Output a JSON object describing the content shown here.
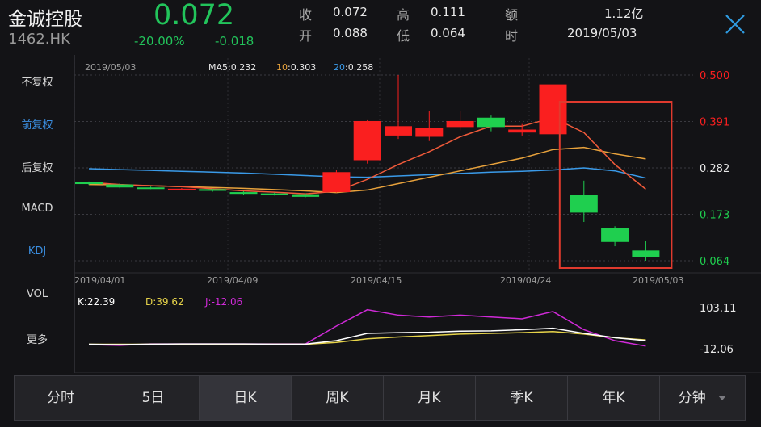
{
  "header": {
    "name": "金诚控股",
    "code": "1462.HK",
    "price": "0.072",
    "change_pct": "-20.00%",
    "change_amt": "-0.018",
    "quote": [
      {
        "label": "收",
        "value": "0.072"
      },
      {
        "label": "开",
        "value": "0.088"
      },
      {
        "label": "高",
        "value": "0.111"
      },
      {
        "label": "低",
        "value": "0.064"
      },
      {
        "label": "额",
        "value": "1.12亿"
      },
      {
        "label": "时",
        "value": "2019/05/03"
      }
    ],
    "close_icon": "close-icon"
  },
  "sidebar": {
    "items": [
      {
        "label": "不复权",
        "active": false
      },
      {
        "label": "前复权",
        "active": true
      },
      {
        "label": "后复权",
        "active": false
      },
      {
        "label": "MACD",
        "active": false
      },
      {
        "label": "KDJ",
        "active": true
      },
      {
        "label": "VOL",
        "active": false
      },
      {
        "label": "更多",
        "active": false
      }
    ]
  },
  "chart_data": {
    "type": "candlestick",
    "date_label": "2019/05/03",
    "ma_legend": {
      "ma5": {
        "name": "MA5",
        "value": "0.232",
        "color": "#e8e8e8"
      },
      "ma10": {
        "name": "10",
        "value": "0.303",
        "color": "#e8a23c"
      },
      "ma20": {
        "name": "20",
        "value": "0.258",
        "color": "#3a9ae8"
      }
    },
    "y_ticks": [
      "0.500",
      "0.391",
      "0.282",
      "0.173",
      "0.064"
    ],
    "y_range": [
      0.064,
      0.5
    ],
    "x_ticks": [
      "2019/04/01",
      "2019/04/09",
      "2019/04/15",
      "2019/04/24",
      "2019/05/03"
    ],
    "candles": [
      {
        "o": 0.248,
        "c": 0.244,
        "h": 0.25,
        "l": 0.242
      },
      {
        "o": 0.243,
        "c": 0.236,
        "h": 0.246,
        "l": 0.234
      },
      {
        "o": 0.236,
        "c": 0.234,
        "h": 0.238,
        "l": 0.232
      },
      {
        "o": 0.233,
        "c": 0.233,
        "h": 0.235,
        "l": 0.231
      },
      {
        "o": 0.232,
        "c": 0.228,
        "h": 0.233,
        "l": 0.226
      },
      {
        "o": 0.225,
        "c": 0.221,
        "h": 0.227,
        "l": 0.219
      },
      {
        "o": 0.222,
        "c": 0.218,
        "h": 0.224,
        "l": 0.217
      },
      {
        "o": 0.22,
        "c": 0.214,
        "h": 0.222,
        "l": 0.213
      },
      {
        "o": 0.225,
        "c": 0.272,
        "h": 0.278,
        "l": 0.224
      },
      {
        "o": 0.3,
        "c": 0.392,
        "h": 0.394,
        "l": 0.292
      },
      {
        "o": 0.358,
        "c": 0.38,
        "h": 0.5,
        "l": 0.35
      },
      {
        "o": 0.355,
        "c": 0.376,
        "h": 0.415,
        "l": 0.345
      },
      {
        "o": 0.378,
        "c": 0.392,
        "h": 0.415,
        "l": 0.37
      },
      {
        "o": 0.4,
        "c": 0.378,
        "h": 0.405,
        "l": 0.368
      },
      {
        "o": 0.365,
        "c": 0.372,
        "h": 0.385,
        "l": 0.358
      },
      {
        "o": 0.361,
        "c": 0.478,
        "h": 0.48,
        "l": 0.355
      },
      {
        "o": 0.219,
        "c": 0.177,
        "h": 0.252,
        "l": 0.155
      },
      {
        "o": 0.14,
        "c": 0.108,
        "h": 0.145,
        "l": 0.098
      },
      {
        "o": 0.088,
        "c": 0.072,
        "h": 0.111,
        "l": 0.064
      }
    ],
    "ma5": [
      0.248,
      0.243,
      0.24,
      0.238,
      0.233,
      0.228,
      0.225,
      0.221,
      0.227,
      0.255,
      0.29,
      0.32,
      0.355,
      0.38,
      0.38,
      0.4,
      0.365,
      0.29,
      0.232
    ],
    "ma10": [
      0.243,
      0.242,
      0.24,
      0.238,
      0.236,
      0.234,
      0.231,
      0.228,
      0.224,
      0.23,
      0.245,
      0.26,
      0.275,
      0.29,
      0.305,
      0.325,
      0.33,
      0.315,
      0.303
    ],
    "ma20": [
      0.28,
      0.278,
      0.276,
      0.274,
      0.272,
      0.27,
      0.267,
      0.264,
      0.261,
      0.26,
      0.263,
      0.266,
      0.269,
      0.272,
      0.274,
      0.277,
      0.282,
      0.275,
      0.258
    ],
    "highlight": {
      "from_index": 16,
      "to_index": 18,
      "color": "#e03a2e"
    },
    "kdj": {
      "legend": {
        "k": "K:22.39",
        "d": "D:39.62",
        "j": "J:-12.06"
      },
      "y_ticks": [
        "103.11",
        "-12.06"
      ],
      "range": [
        -12.06,
        103.11
      ],
      "k": [
        0,
        -1,
        0.5,
        1,
        1,
        1,
        0.5,
        0.5,
        10,
        30,
        32,
        33,
        36,
        37,
        40,
        44,
        30,
        18,
        10
      ],
      "d": [
        0,
        0,
        0,
        0,
        0,
        0,
        0,
        0,
        5,
        15,
        20,
        24,
        28,
        30,
        32,
        35,
        28,
        18,
        12
      ],
      "j": [
        -1,
        -3,
        1,
        1,
        1,
        1,
        1,
        1,
        50,
        95,
        80,
        75,
        80,
        75,
        70,
        90,
        40,
        10,
        -5
      ]
    },
    "colors": {
      "up": "#fa1f1f",
      "down": "#1fcf4f",
      "ma5": "#e8e8e8",
      "ma10": "#e8a23c",
      "ma20": "#3a9ae8",
      "k": "#ffffff",
      "d": "#e6d34a",
      "j": "#d02ad8"
    }
  },
  "tabs": [
    {
      "label": "分时",
      "active": false
    },
    {
      "label": "5日",
      "active": false
    },
    {
      "label": "日K",
      "active": true
    },
    {
      "label": "周K",
      "active": false
    },
    {
      "label": "月K",
      "active": false
    },
    {
      "label": "季K",
      "active": false
    },
    {
      "label": "年K",
      "active": false
    },
    {
      "label": "分钟",
      "active": false,
      "dropdown": true
    }
  ]
}
